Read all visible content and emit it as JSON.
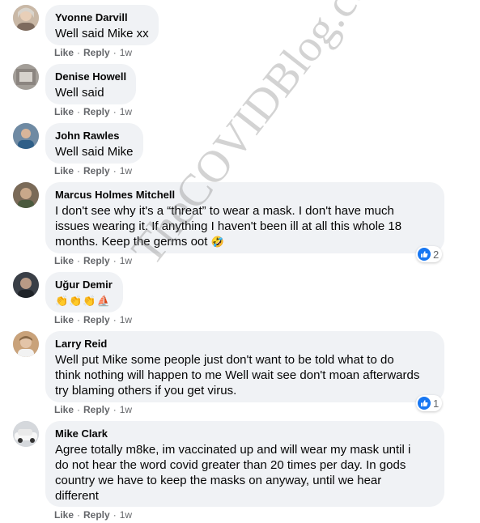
{
  "actions": {
    "like": "Like",
    "reply": "Reply",
    "separator": "·"
  },
  "comments": [
    {
      "author": "Yvonne Darvill",
      "lines": [
        "Well said Mike xx"
      ],
      "time": "1w"
    },
    {
      "author": "Denise Howell",
      "lines": [
        "Well said"
      ],
      "time": "1w"
    },
    {
      "author": "John Rawles",
      "lines": [
        "Well said Mike"
      ],
      "time": "1w"
    },
    {
      "author": "Marcus Holmes Mitchell",
      "lines": [
        "I don't see why it's a “threat” to wear a mask. I don't have much",
        "issues wearing it. If anything I haven't been ill at all this whole 18",
        "months. Keep the germs oot"
      ],
      "emoji": "🤣",
      "time": "1w",
      "reaction_count": "2",
      "reaction_icon": "thumbs-up-icon"
    },
    {
      "author": "Uğur Demir",
      "lines": [],
      "emoji": "👏👏👏⛵",
      "time": "1w"
    },
    {
      "author": "Larry Reid",
      "lines": [
        "Well put Mike some people just don't want to be told what to do",
        "think nothing will happen to me Well wait see don't moan afterwards",
        "try blaming others if you get virus."
      ],
      "time": "1w",
      "reaction_count": "1",
      "reaction_icon": "thumbs-up-icon"
    },
    {
      "author": "Mike Clark",
      "lines": [
        "Agree totally m8ke, im vaccinated up and will wear my mask until i",
        "do not hear the word covid greater than 20 times per day. In gods",
        "country we have to keep the masks on anyway, until we hear",
        "different"
      ],
      "time": "1w"
    }
  ],
  "watermark": "TheCOVIDBlog.com",
  "colors": {
    "bubble": "#f0f2f5",
    "meta": "#65676b",
    "like_blue": "#1877f2",
    "text": "#050505"
  }
}
